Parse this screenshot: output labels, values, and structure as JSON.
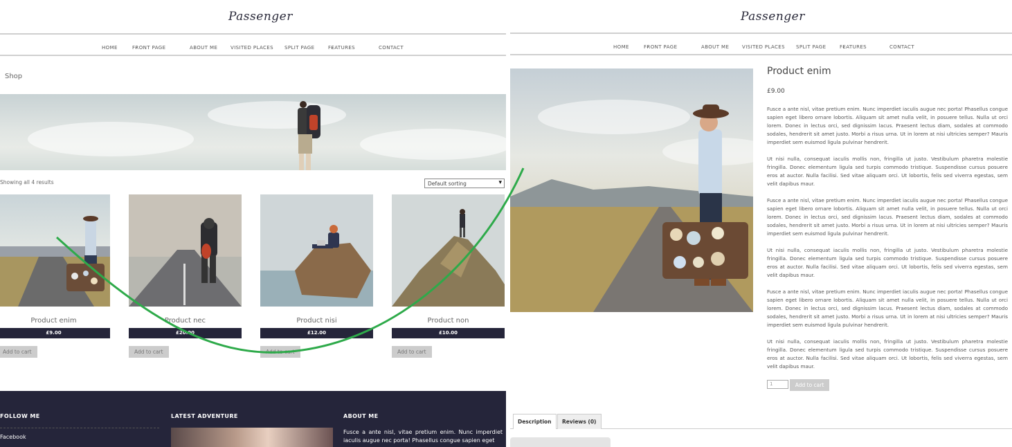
{
  "shop_page": {
    "logo": "Passenger",
    "nav": [
      {
        "label": "HOME",
        "dropdown": false
      },
      {
        "label": "FRONT PAGE",
        "dropdown": true
      },
      {
        "label": "ABOUT ME",
        "dropdown": false
      },
      {
        "label": "VISITED PLACES",
        "dropdown": false
      },
      {
        "label": "SPLIT PAGE",
        "dropdown": false
      },
      {
        "label": "FEATURES",
        "dropdown": true
      },
      {
        "label": "CONTACT",
        "dropdown": false
      }
    ],
    "breadcrumb": "Shop",
    "results_text": "Showing all 4 results",
    "sorting": {
      "selected": "Default sorting"
    },
    "products": [
      {
        "name": "Product enim",
        "price": "£9.00",
        "button": "Add to cart"
      },
      {
        "name": "Product nec",
        "price": "£20.00",
        "button": "Add to cart"
      },
      {
        "name": "Product nisi",
        "price": "£12.00",
        "button": "Add to cart"
      },
      {
        "name": "Product non",
        "price": "£10.00",
        "button": "Add to cart"
      }
    ],
    "footer": {
      "follow_heading": "FOLLOW ME",
      "follow_link": "Facebook",
      "adventure_heading": "LATEST ADVENTURE",
      "about_heading": "ABOUT ME",
      "about_text": "Fusce a ante nisl, vitae pretium enim. Nunc imperdiet iaculis augue nec porta! Phasellus congue sapien eget"
    }
  },
  "product_page": {
    "logo": "Passenger",
    "nav": [
      {
        "label": "HOME",
        "dropdown": false
      },
      {
        "label": "FRONT PAGE",
        "dropdown": true
      },
      {
        "label": "ABOUT ME",
        "dropdown": false
      },
      {
        "label": "VISITED PLACES",
        "dropdown": false
      },
      {
        "label": "SPLIT PAGE",
        "dropdown": false
      },
      {
        "label": "FEATURES",
        "dropdown": true
      },
      {
        "label": "CONTACT",
        "dropdown": false
      }
    ],
    "title": "Product enim",
    "price": "£9.00",
    "paragraphs": [
      "Fusce a ante nisl, vitae pretium enim. Nunc imperdiet iaculis augue nec porta! Phasellus congue sapien eget libero ornare lobortis. Aliquam sit amet nulla velit, in posuere tellus. Nulla ut orci lorem. Donec in lectus orci, sed dignissim lacus. Praesent lectus diam, sodales at commodo sodales, hendrerit sit amet justo. Morbi a risus urna. Ut in lorem at nisi ultricies semper? Mauris imperdiet sem euismod ligula pulvinar hendrerit.",
      "Ut nisi nulla, consequat iaculis mollis non, fringilla ut justo. Vestibulum pharetra molestie fringilla. Donec elementum ligula sed turpis commodo tristique. Suspendisse cursus posuere eros at auctor. Nulla facilisi. Sed vitae aliquam orci. Ut lobortis, felis sed viverra egestas, sem velit dapibus maur.",
      "Fusce a ante nisl, vitae pretium enim. Nunc imperdiet iaculis augue nec porta! Phasellus congue sapien eget libero ornare lobortis. Aliquam sit amet nulla velit, in posuere tellus. Nulla ut orci lorem. Donec in lectus orci, sed dignissim lacus. Praesent lectus diam, sodales at commodo sodales, hendrerit sit amet justo. Morbi a risus urna. Ut in lorem at nisi ultricies semper? Mauris imperdiet sem euismod ligula pulvinar hendrerit.",
      "Ut nisi nulla, consequat iaculis mollis non, fringilla ut justo. Vestibulum pharetra molestie fringilla. Donec elementum ligula sed turpis commodo tristique. Suspendisse cursus posuere eros at auctor. Nulla facilisi. Sed vitae aliquam orci. Ut lobortis, felis sed viverra egestas, sem velit dapibus maur.",
      "Fusce a ante nisl, vitae pretium enim. Nunc imperdiet iaculis augue nec porta! Phasellus congue sapien eget libero ornare lobortis. Aliquam sit amet nulla velit, in posuere tellus. Nulla ut orci lorem. Donec in lectus orci, sed dignissim lacus. Praesent lectus diam, sodales at commodo sodales, hendrerit sit amet justo. Morbi a risus urna. Ut in lorem at nisi ultricies semper? Mauris imperdiet sem euismod ligula pulvinar hendrerit.",
      "Ut nisi nulla, consequat iaculis mollis non, fringilla ut justo. Vestibulum pharetra molestie fringilla. Donec elementum ligula sed turpis commodo tristique. Suspendisse cursus posuere eros at auctor. Nulla facilisi. Sed vitae aliquam orci. Ut lobortis, felis sed viverra egestas, sem velit dapibus maur."
    ],
    "quantity": "1",
    "add_to_cart": "Add to cart",
    "tabs": [
      {
        "label": "Description",
        "active": true
      },
      {
        "label": "Reviews (0)",
        "active": false
      }
    ]
  },
  "colors": {
    "dark_navy": "#25253a",
    "button_gray": "#cccccc",
    "arrow_green": "#2eaa4a"
  },
  "icons": [
    "chevron-down-icon",
    "select-arrow-icon",
    "curved-arrow-annotation"
  ]
}
